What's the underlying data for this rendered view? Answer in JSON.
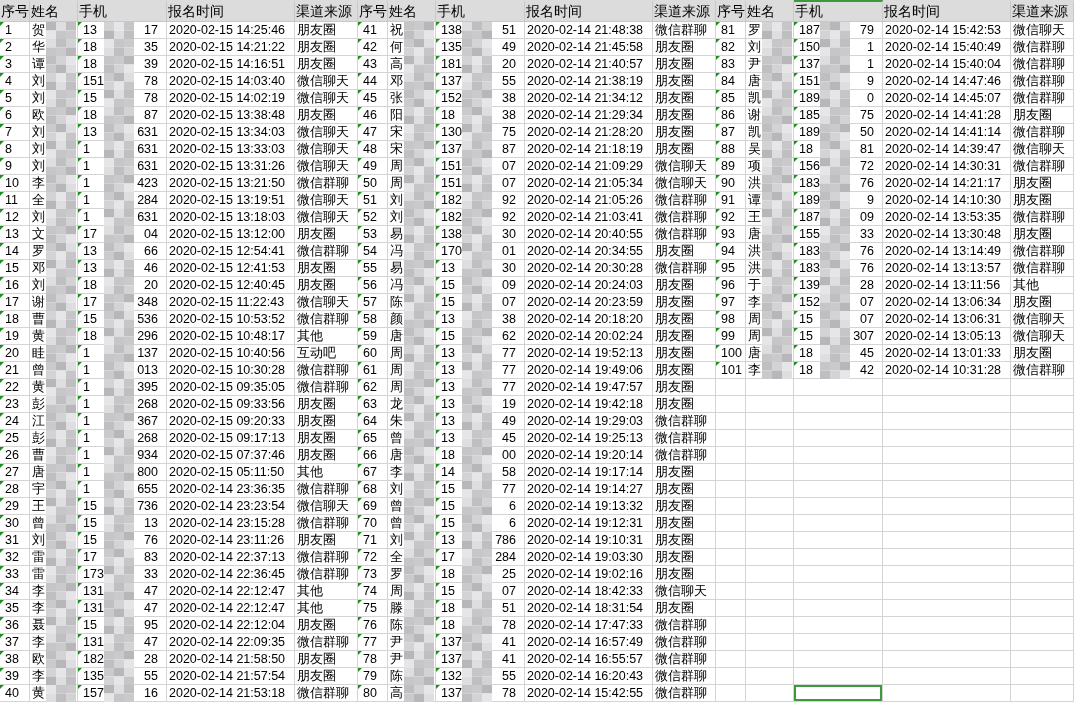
{
  "blocks": [
    {
      "columns": [
        "序号",
        "姓名",
        "手机",
        "报名时间",
        "渠道来源"
      ],
      "rows": [
        {
          "no": "1",
          "name": "贺",
          "phone_start": "13",
          "phone_end": "17",
          "time": "2020-02-15 14:25:46",
          "channel": "朋友圈"
        },
        {
          "no": "2",
          "name": "华",
          "phone_start": "18",
          "phone_end": "35",
          "time": "2020-02-15 14:21:22",
          "channel": "朋友圈"
        },
        {
          "no": "3",
          "name": "谭",
          "phone_start": "18",
          "phone_end": "39",
          "time": "2020-02-15 14:16:51",
          "channel": "朋友圈"
        },
        {
          "no": "4",
          "name": "刘",
          "phone_start": "151",
          "phone_end": "78",
          "time": "2020-02-15 14:03:40",
          "channel": "微信聊天"
        },
        {
          "no": "5",
          "name": "刘",
          "phone_start": "15",
          "phone_end": "78",
          "time": "2020-02-15 14:02:19",
          "channel": "微信聊天"
        },
        {
          "no": "6",
          "name": "欧",
          "phone_start": "18",
          "phone_end": "87",
          "time": "2020-02-15 13:38:48",
          "channel": "朋友圈"
        },
        {
          "no": "7",
          "name": "刘",
          "phone_start": "13",
          "phone_end": "631",
          "time": "2020-02-15 13:34:03",
          "channel": "微信聊天"
        },
        {
          "no": "8",
          "name": "刘",
          "phone_start": "1",
          "phone_end": "631",
          "time": "2020-02-15 13:33:03",
          "channel": "微信聊天"
        },
        {
          "no": "9",
          "name": "刘",
          "phone_start": "1",
          "phone_end": "631",
          "time": "2020-02-15 13:31:26",
          "channel": "微信聊天"
        },
        {
          "no": "10",
          "name": "李",
          "phone_start": "1",
          "phone_end": "423",
          "time": "2020-02-15 13:21:50",
          "channel": "微信群聊"
        },
        {
          "no": "11",
          "name": "全",
          "phone_start": "1",
          "phone_end": "284",
          "time": "2020-02-15 13:19:51",
          "channel": "微信聊天"
        },
        {
          "no": "12",
          "name": "刘",
          "phone_start": "1",
          "phone_end": "631",
          "time": "2020-02-15 13:18:03",
          "channel": "微信聊天"
        },
        {
          "no": "13",
          "name": "文",
          "phone_start": "17",
          "phone_end": "04",
          "time": "2020-02-15 13:12:00",
          "channel": "朋友圈"
        },
        {
          "no": "14",
          "name": "罗",
          "phone_start": "13",
          "phone_end": "66",
          "time": "2020-02-15 12:54:41",
          "channel": "微信群聊"
        },
        {
          "no": "15",
          "name": "邓",
          "phone_start": "13",
          "phone_end": "46",
          "time": "2020-02-15 12:41:53",
          "channel": "朋友圈"
        },
        {
          "no": "16",
          "name": "刘",
          "phone_start": "18",
          "phone_end": "20",
          "time": "2020-02-15 12:40:45",
          "channel": "朋友圈"
        },
        {
          "no": "17",
          "name": "谢",
          "phone_start": "17",
          "phone_end": "348",
          "time": "2020-02-15 11:22:43",
          "channel": "微信聊天"
        },
        {
          "no": "18",
          "name": "曹",
          "phone_start": "15",
          "phone_end": "536",
          "time": "2020-02-15 10:53:52",
          "channel": "微信群聊"
        },
        {
          "no": "19",
          "name": "黄",
          "phone_start": "18",
          "phone_end": "296",
          "time": "2020-02-15 10:48:17",
          "channel": "其他"
        },
        {
          "no": "20",
          "name": "眭",
          "phone_start": "1",
          "phone_end": "137",
          "time": "2020-02-15 10:40:56",
          "channel": "互动吧"
        },
        {
          "no": "21",
          "name": "曾",
          "phone_start": "1",
          "phone_end": "013",
          "time": "2020-02-15 10:30:28",
          "channel": "微信群聊"
        },
        {
          "no": "22",
          "name": "黄",
          "phone_start": "1",
          "phone_end": "395",
          "time": "2020-02-15 09:35:05",
          "channel": "微信群聊"
        },
        {
          "no": "23",
          "name": "彭",
          "phone_start": "1",
          "phone_end": "268",
          "time": "2020-02-15 09:33:56",
          "channel": "朋友圈"
        },
        {
          "no": "24",
          "name": "江",
          "phone_start": "1",
          "phone_end": "367",
          "time": "2020-02-15 09:20:33",
          "channel": "朋友圈"
        },
        {
          "no": "25",
          "name": "彭",
          "phone_start": "1",
          "phone_end": "268",
          "time": "2020-02-15 09:17:13",
          "channel": "朋友圈"
        },
        {
          "no": "26",
          "name": "曹",
          "phone_start": "1",
          "phone_end": "934",
          "time": "2020-02-15 07:37:46",
          "channel": "朋友圈"
        },
        {
          "no": "27",
          "name": "唐",
          "phone_start": "1",
          "phone_end": "800",
          "time": "2020-02-15 05:11:50",
          "channel": "其他"
        },
        {
          "no": "28",
          "name": "宇",
          "phone_start": "1",
          "phone_end": "655",
          "time": "2020-02-14 23:36:35",
          "channel": "微信群聊"
        },
        {
          "no": "29",
          "name": "王",
          "phone_start": "15",
          "phone_end": "736",
          "time": "2020-02-14 23:23:54",
          "channel": "微信聊天"
        },
        {
          "no": "30",
          "name": "曾",
          "phone_start": "15",
          "phone_end": "13",
          "time": "2020-02-14 23:15:28",
          "channel": "微信群聊"
        },
        {
          "no": "31",
          "name": "刘",
          "phone_start": "15",
          "phone_end": "76",
          "time": "2020-02-14 23:11:26",
          "channel": "朋友圈"
        },
        {
          "no": "32",
          "name": "雷",
          "phone_start": "17",
          "phone_end": "83",
          "time": "2020-02-14 22:37:13",
          "channel": "微信群聊"
        },
        {
          "no": "33",
          "name": "雷",
          "phone_start": "173",
          "phone_end": "33",
          "time": "2020-02-14 22:36:45",
          "channel": "微信群聊"
        },
        {
          "no": "34",
          "name": "李",
          "phone_start": "131",
          "phone_end": "47",
          "time": "2020-02-14 22:12:47",
          "channel": "其他"
        },
        {
          "no": "35",
          "name": "李",
          "phone_start": "131",
          "phone_end": "47",
          "time": "2020-02-14 22:12:47",
          "channel": "其他"
        },
        {
          "no": "36",
          "name": "聂",
          "phone_start": "15",
          "phone_end": "95",
          "time": "2020-02-14 22:12:04",
          "channel": "朋友圈"
        },
        {
          "no": "37",
          "name": "李",
          "phone_start": "131",
          "phone_end": "47",
          "time": "2020-02-14 22:09:35",
          "channel": "微信群聊"
        },
        {
          "no": "38",
          "name": "欧",
          "phone_start": "182",
          "phone_end": "28",
          "time": "2020-02-14 21:58:50",
          "channel": "朋友圈"
        },
        {
          "no": "39",
          "name": "李",
          "phone_start": "135",
          "phone_end": "55",
          "time": "2020-02-14 21:57:54",
          "channel": "朋友圈"
        },
        {
          "no": "40",
          "name": "黄",
          "phone_start": "157",
          "phone_end": "16",
          "time": "2020-02-14 21:53:18",
          "channel": "微信群聊"
        }
      ]
    },
    {
      "columns": [
        "序号",
        "姓名",
        "手机",
        "报名时间",
        "渠道来源"
      ],
      "rows": [
        {
          "no": "41",
          "name": "祝",
          "phone_start": "138",
          "phone_end": "51",
          "time": "2020-02-14 21:48:38",
          "channel": "微信群聊"
        },
        {
          "no": "42",
          "name": "何",
          "phone_start": "135",
          "phone_end": "49",
          "time": "2020-02-14 21:45:58",
          "channel": "朋友圈"
        },
        {
          "no": "43",
          "name": "高",
          "phone_start": "181",
          "phone_end": "20",
          "time": "2020-02-14 21:40:57",
          "channel": "朋友圈"
        },
        {
          "no": "44",
          "name": "邓",
          "phone_start": "137",
          "phone_end": "55",
          "time": "2020-02-14 21:38:19",
          "channel": "朋友圈"
        },
        {
          "no": "45",
          "name": "张",
          "phone_start": "152",
          "phone_end": "38",
          "time": "2020-02-14 21:34:12",
          "channel": "朋友圈"
        },
        {
          "no": "46",
          "name": "阳",
          "phone_start": "18",
          "phone_end": "38",
          "time": "2020-02-14 21:29:34",
          "channel": "朋友圈"
        },
        {
          "no": "47",
          "name": "宋",
          "phone_start": "130",
          "phone_end": "75",
          "time": "2020-02-14 21:28:20",
          "channel": "朋友圈"
        },
        {
          "no": "48",
          "name": "宋",
          "phone_start": "137",
          "phone_end": "87",
          "time": "2020-02-14 21:18:19",
          "channel": "朋友圈"
        },
        {
          "no": "49",
          "name": "周",
          "phone_start": "151",
          "phone_end": "07",
          "time": "2020-02-14 21:09:29",
          "channel": "微信聊天"
        },
        {
          "no": "50",
          "name": "周",
          "phone_start": "151",
          "phone_end": "07",
          "time": "2020-02-14 21:05:34",
          "channel": "微信聊天"
        },
        {
          "no": "51",
          "name": "刘",
          "phone_start": "182",
          "phone_end": "92",
          "time": "2020-02-14 21:05:26",
          "channel": "微信群聊"
        },
        {
          "no": "52",
          "name": "刘",
          "phone_start": "182",
          "phone_end": "92",
          "time": "2020-02-14 21:03:41",
          "channel": "微信群聊"
        },
        {
          "no": "53",
          "name": "易",
          "phone_start": "138",
          "phone_end": "30",
          "time": "2020-02-14 20:40:55",
          "channel": "微信群聊"
        },
        {
          "no": "54",
          "name": "冯",
          "phone_start": "170",
          "phone_end": "01",
          "time": "2020-02-14 20:34:55",
          "channel": "朋友圈"
        },
        {
          "no": "55",
          "name": "易",
          "phone_start": "13",
          "phone_end": "30",
          "time": "2020-02-14 20:30:28",
          "channel": "微信群聊"
        },
        {
          "no": "56",
          "name": "冯",
          "phone_start": "15",
          "phone_end": "09",
          "time": "2020-02-14 20:24:03",
          "channel": "朋友圈"
        },
        {
          "no": "57",
          "name": "陈",
          "phone_start": "15",
          "phone_end": "07",
          "time": "2020-02-14 20:23:59",
          "channel": "朋友圈"
        },
        {
          "no": "58",
          "name": "颜",
          "phone_start": "13",
          "phone_end": "38",
          "time": "2020-02-14 20:18:20",
          "channel": "朋友圈"
        },
        {
          "no": "59",
          "name": "唐",
          "phone_start": "15",
          "phone_end": "62",
          "time": "2020-02-14 20:02:24",
          "channel": "朋友圈"
        },
        {
          "no": "60",
          "name": "周",
          "phone_start": "13",
          "phone_end": "77",
          "time": "2020-02-14 19:52:13",
          "channel": "朋友圈"
        },
        {
          "no": "61",
          "name": "周",
          "phone_start": "13",
          "phone_end": "77",
          "time": "2020-02-14 19:49:06",
          "channel": "朋友圈"
        },
        {
          "no": "62",
          "name": "周",
          "phone_start": "13",
          "phone_end": "77",
          "time": "2020-02-14 19:47:57",
          "channel": "朋友圈"
        },
        {
          "no": "63",
          "name": "龙",
          "phone_start": "13",
          "phone_end": "19",
          "time": "2020-02-14 19:42:18",
          "channel": "朋友圈"
        },
        {
          "no": "64",
          "name": "朱",
          "phone_start": "13",
          "phone_end": "49",
          "time": "2020-02-14 19:29:03",
          "channel": "微信群聊"
        },
        {
          "no": "65",
          "name": "曾",
          "phone_start": "13",
          "phone_end": "45",
          "time": "2020-02-14 19:25:13",
          "channel": "微信群聊"
        },
        {
          "no": "66",
          "name": "唐",
          "phone_start": "18",
          "phone_end": "00",
          "time": "2020-02-14 19:20:14",
          "channel": "微信群聊"
        },
        {
          "no": "67",
          "name": "李",
          "phone_start": "14",
          "phone_end": "58",
          "time": "2020-02-14 19:17:14",
          "channel": "朋友圈"
        },
        {
          "no": "68",
          "name": "刘",
          "phone_start": "15",
          "phone_end": "77",
          "time": "2020-02-14 19:14:27",
          "channel": "朋友圈"
        },
        {
          "no": "69",
          "name": "曾",
          "phone_start": "15",
          "phone_end": "6",
          "time": "2020-02-14 19:13:32",
          "channel": "朋友圈"
        },
        {
          "no": "70",
          "name": "曾",
          "phone_start": "15",
          "phone_end": "6",
          "time": "2020-02-14 19:12:31",
          "channel": "朋友圈"
        },
        {
          "no": "71",
          "name": "刘",
          "phone_start": "13",
          "phone_end": "786",
          "time": "2020-02-14 19:10:31",
          "channel": "朋友圈"
        },
        {
          "no": "72",
          "name": "全",
          "phone_start": "17",
          "phone_end": "284",
          "time": "2020-02-14 19:03:30",
          "channel": "朋友圈"
        },
        {
          "no": "73",
          "name": "罗",
          "phone_start": "18",
          "phone_end": "25",
          "time": "2020-02-14 19:02:16",
          "channel": "朋友圈"
        },
        {
          "no": "74",
          "name": "周",
          "phone_start": "15",
          "phone_end": "07",
          "time": "2020-02-14 18:42:33",
          "channel": "微信聊天"
        },
        {
          "no": "75",
          "name": "滕",
          "phone_start": "18",
          "phone_end": "51",
          "time": "2020-02-14 18:31:54",
          "channel": "朋友圈"
        },
        {
          "no": "76",
          "name": "陈",
          "phone_start": "18",
          "phone_end": "78",
          "time": "2020-02-14 17:47:33",
          "channel": "微信群聊"
        },
        {
          "no": "77",
          "name": "尹",
          "phone_start": "137",
          "phone_end": "41",
          "time": "2020-02-14 16:57:49",
          "channel": "微信群聊"
        },
        {
          "no": "78",
          "name": "尹",
          "phone_start": "137",
          "phone_end": "41",
          "time": "2020-02-14 16:55:57",
          "channel": "微信群聊"
        },
        {
          "no": "79",
          "name": "陈",
          "phone_start": "132",
          "phone_end": "55",
          "time": "2020-02-14 16:20:43",
          "channel": "微信群聊"
        },
        {
          "no": "80",
          "name": "高",
          "phone_start": "137",
          "phone_end": "78",
          "time": "2020-02-14 15:42:55",
          "channel": "微信群聊"
        }
      ]
    },
    {
      "columns": [
        "序号",
        "姓名",
        "手机",
        "报名时间",
        "渠道来源"
      ],
      "rows": [
        {
          "no": "81",
          "name": "罗",
          "phone_start": "187",
          "phone_end": "79",
          "time": "2020-02-14 15:42:53",
          "channel": "微信聊天"
        },
        {
          "no": "82",
          "name": "刘",
          "phone_start": "150",
          "phone_end": "1",
          "time": "2020-02-14 15:40:49",
          "channel": "微信群聊"
        },
        {
          "no": "83",
          "name": "尹",
          "phone_start": "137",
          "phone_end": "1",
          "time": "2020-02-14 15:40:04",
          "channel": "微信群聊"
        },
        {
          "no": "84",
          "name": "唐",
          "phone_start": "151",
          "phone_end": "9",
          "time": "2020-02-14 14:47:46",
          "channel": "微信群聊"
        },
        {
          "no": "85",
          "name": "凯",
          "phone_start": "189",
          "phone_end": "0",
          "time": "2020-02-14 14:45:07",
          "channel": "微信群聊"
        },
        {
          "no": "86",
          "name": "谢",
          "phone_start": "185",
          "phone_end": "75",
          "time": "2020-02-14 14:41:28",
          "channel": "朋友圈"
        },
        {
          "no": "87",
          "name": "凯",
          "phone_start": "189",
          "phone_end": "50",
          "time": "2020-02-14 14:41:14",
          "channel": "微信群聊"
        },
        {
          "no": "88",
          "name": "吴",
          "phone_start": "18",
          "phone_end": "81",
          "time": "2020-02-14 14:39:47",
          "channel": "微信聊天"
        },
        {
          "no": "89",
          "name": "项",
          "phone_start": "156",
          "phone_end": "72",
          "time": "2020-02-14 14:30:31",
          "channel": "微信群聊"
        },
        {
          "no": "90",
          "name": "洪",
          "phone_start": "183",
          "phone_end": "76",
          "time": "2020-02-14 14:21:17",
          "channel": "朋友圈"
        },
        {
          "no": "91",
          "name": "谭",
          "phone_start": "189",
          "phone_end": "9",
          "time": "2020-02-14 14:10:30",
          "channel": "朋友圈"
        },
        {
          "no": "92",
          "name": "王",
          "phone_start": "187",
          "phone_end": "09",
          "time": "2020-02-14 13:53:35",
          "channel": "微信群聊"
        },
        {
          "no": "93",
          "name": "唐",
          "phone_start": "155",
          "phone_end": "33",
          "time": "2020-02-14 13:30:48",
          "channel": "朋友圈"
        },
        {
          "no": "94",
          "name": "洪",
          "phone_start": "183",
          "phone_end": "76",
          "time": "2020-02-14 13:14:49",
          "channel": "微信群聊"
        },
        {
          "no": "95",
          "name": "洪",
          "phone_start": "183",
          "phone_end": "76",
          "time": "2020-02-14 13:13:57",
          "channel": "微信群聊"
        },
        {
          "no": "96",
          "name": "于",
          "phone_start": "139",
          "phone_end": "28",
          "time": "2020-02-14 13:11:56",
          "channel": "其他"
        },
        {
          "no": "97",
          "name": "李",
          "phone_start": "152",
          "phone_end": "07",
          "time": "2020-02-14 13:06:34",
          "channel": "朋友圈"
        },
        {
          "no": "98",
          "name": "周",
          "phone_start": "15",
          "phone_end": "07",
          "time": "2020-02-14 13:06:31",
          "channel": "微信聊天"
        },
        {
          "no": "99",
          "name": "周",
          "phone_start": "15",
          "phone_end": "307",
          "time": "2020-02-14 13:05:13",
          "channel": "微信聊天"
        },
        {
          "no": "100",
          "name": "唐",
          "phone_start": "18",
          "phone_end": "45",
          "time": "2020-02-14 13:01:33",
          "channel": "朋友圈"
        },
        {
          "no": "101",
          "name": "李",
          "phone_start": "18",
          "phone_end": "42",
          "time": "2020-02-14 10:31:28",
          "channel": "微信群聊"
        }
      ],
      "empty_rows": [
        {
          "cells": [
            {
              "selected": false
            },
            {
              "selected": false
            },
            {
              "selected": false
            },
            {
              "selected": false
            },
            {
              "selected": false
            }
          ]
        },
        {
          "cells": [
            {
              "selected": false
            },
            {
              "selected": false
            },
            {
              "selected": false
            },
            {
              "selected": false
            },
            {
              "selected": false
            }
          ]
        },
        {
          "cells": [
            {
              "selected": false
            },
            {
              "selected": false
            },
            {
              "selected": false
            },
            {
              "selected": false
            },
            {
              "selected": false
            }
          ]
        },
        {
          "cells": [
            {
              "selected": false
            },
            {
              "selected": false
            },
            {
              "selected": false
            },
            {
              "selected": false
            },
            {
              "selected": false
            }
          ]
        },
        {
          "cells": [
            {
              "selected": false
            },
            {
              "selected": false
            },
            {
              "selected": false
            },
            {
              "selected": false
            },
            {
              "selected": false
            }
          ]
        },
        {
          "cells": [
            {
              "selected": false
            },
            {
              "selected": false
            },
            {
              "selected": false
            },
            {
              "selected": false
            },
            {
              "selected": false
            }
          ]
        },
        {
          "cells": [
            {
              "selected": false
            },
            {
              "selected": false
            },
            {
              "selected": false
            },
            {
              "selected": false
            },
            {
              "selected": false
            }
          ]
        },
        {
          "cells": [
            {
              "selected": false
            },
            {
              "selected": false
            },
            {
              "selected": false
            },
            {
              "selected": false
            },
            {
              "selected": false
            }
          ]
        },
        {
          "cells": [
            {
              "selected": false
            },
            {
              "selected": false
            },
            {
              "selected": false
            },
            {
              "selected": false
            },
            {
              "selected": false
            }
          ]
        },
        {
          "cells": [
            {
              "selected": false
            },
            {
              "selected": false
            },
            {
              "selected": false
            },
            {
              "selected": false
            },
            {
              "selected": false
            }
          ]
        },
        {
          "cells": [
            {
              "selected": false
            },
            {
              "selected": false
            },
            {
              "selected": false
            },
            {
              "selected": false
            },
            {
              "selected": false
            }
          ]
        },
        {
          "cells": [
            {
              "selected": false
            },
            {
              "selected": false
            },
            {
              "selected": false
            },
            {
              "selected": false
            },
            {
              "selected": false
            }
          ]
        },
        {
          "cells": [
            {
              "selected": false
            },
            {
              "selected": false
            },
            {
              "selected": false
            },
            {
              "selected": false
            },
            {
              "selected": false
            }
          ]
        },
        {
          "cells": [
            {
              "selected": false
            },
            {
              "selected": false
            },
            {
              "selected": false
            },
            {
              "selected": false
            },
            {
              "selected": false
            }
          ]
        },
        {
          "cells": [
            {
              "selected": false
            },
            {
              "selected": false
            },
            {
              "selected": false
            },
            {
              "selected": false
            },
            {
              "selected": false
            }
          ]
        },
        {
          "cells": [
            {
              "selected": false
            },
            {
              "selected": false
            },
            {
              "selected": false
            },
            {
              "selected": false
            },
            {
              "selected": false
            }
          ]
        },
        {
          "cells": [
            {
              "selected": false
            },
            {
              "selected": false
            },
            {
              "selected": false
            },
            {
              "selected": false
            },
            {
              "selected": false
            }
          ]
        },
        {
          "cells": [
            {
              "selected": false
            },
            {
              "selected": false
            },
            {
              "selected": false
            },
            {
              "selected": false
            },
            {
              "selected": false
            }
          ]
        },
        {
          "cells": [
            {
              "selected": false
            },
            {
              "selected": false
            },
            {
              "selected": true
            },
            {
              "selected": false
            },
            {
              "selected": false
            }
          ]
        }
      ]
    }
  ]
}
